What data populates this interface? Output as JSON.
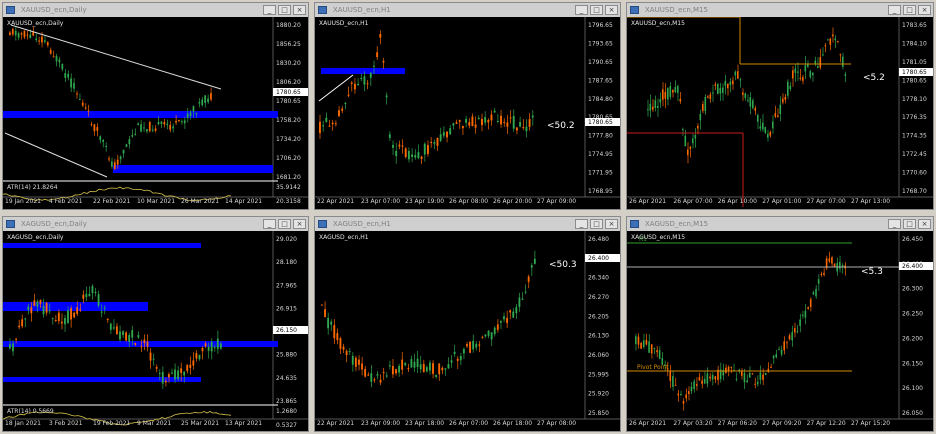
{
  "windows": [
    {
      "id": "w1",
      "title": "XAUUSD_ecn,Daily",
      "symbol_label": "XAUUSD_ecn,Daily",
      "annotation": "",
      "price_labels": [
        "1880.20",
        "1856.25",
        "1830.20",
        "1806.20",
        "1780.65",
        "1758.20",
        "1734.20",
        "1706.20",
        "1681.20"
      ],
      "current_price": "1780.65",
      "date_labels": [
        "19 Jan 2021",
        "4 Feb 2021",
        "22 Feb 2021",
        "10 Mar 2021",
        "26 Mar 2021",
        "14 Apr 2021"
      ],
      "indicator": {
        "label": "ATR(14) 21.8264",
        "scale_labels": [
          "35.9142",
          "20.3158"
        ]
      }
    },
    {
      "id": "w2",
      "title": "XAUUSD_ecn,H1",
      "symbol_label": "XAUUSD_ecn,H1",
      "annotation": "<50.2",
      "price_labels": [
        "1796.65",
        "1793.65",
        "1790.65",
        "1787.65",
        "1784.80",
        "1780.65",
        "1777.80",
        "1774.95",
        "1771.95",
        "1768.95"
      ],
      "current_price": "1780.65",
      "date_labels": [
        "22 Apr 2021",
        "23 Apr 07:00",
        "23 Apr 19:00",
        "26 Apr 08:00",
        "26 Apr 20:00",
        "27 Apr 09:00"
      ]
    },
    {
      "id": "w3",
      "title": "XAUUSD_ecn,M15",
      "symbol_label": "XAUUSD_ecn,M15",
      "annotation": "<5.2",
      "price_labels": [
        "1783.65",
        "1784.10",
        "1781.05",
        "1780.65",
        "1778.10",
        "1776.35",
        "1774.35",
        "1772.45",
        "1770.60",
        "1768.70"
      ],
      "current_price": "1780.65",
      "date_labels": [
        "26 Apr 2021",
        "26 Apr 07:00",
        "26 Apr 10:00",
        "27 Apr 01:00",
        "27 Apr 07:00",
        "27 Apr 13:00"
      ]
    },
    {
      "id": "w4",
      "title": "XAGUSD_ecn,Daily",
      "symbol_label": "XAGUSD_ecn,Daily",
      "annotation": "",
      "price_labels": [
        "29.020",
        "28.180",
        "27.965",
        "26.915",
        "26.150",
        "25.880",
        "24.635",
        "23.865"
      ],
      "current_price": "26.150",
      "date_labels": [
        "18 Jan 2021",
        "3 Feb 2021",
        "19 Feb 2021",
        "9 Mar 2021",
        "25 Mar 2021",
        "13 Apr 2021"
      ],
      "indicator": {
        "label": "ATR(14) 0.5669",
        "scale_labels": [
          "1.2680",
          "0.5327"
        ]
      }
    },
    {
      "id": "w5",
      "title": "XAGUSD_ecn,H1",
      "symbol_label": "XAGUSD_ecn,H1",
      "annotation": "<50.3",
      "price_labels": [
        "26.480",
        "26.400",
        "26.340",
        "26.270",
        "26.205",
        "26.130",
        "26.060",
        "25.995",
        "25.920",
        "25.850"
      ],
      "current_price": "26.400",
      "date_labels": [
        "22 Apr 2021",
        "23 Apr 09:00",
        "23 Apr 18:00",
        "26 Apr 07:00",
        "26 Apr 18:00",
        "27 Apr 08:00"
      ]
    },
    {
      "id": "w6",
      "title": "XAGUSD_ecn,M15",
      "symbol_label": "XAGUSD_ecn,M15",
      "annotation": "<5.3",
      "price_labels": [
        "26.450",
        "26.400",
        "26.300",
        "26.250",
        "26.200",
        "26.150",
        "26.100",
        "26.050"
      ],
      "current_price": "26.400",
      "line_labels": {
        "r1": "R1",
        "pivot": "Pivot Point"
      },
      "date_labels": [
        "26 Apr 2021",
        "27 Apr 03:20",
        "27 Apr 06:20",
        "27 Apr 09:20",
        "27 Apr 12:20",
        "27 Apr 15:20"
      ]
    }
  ],
  "window_buttons": [
    "_",
    "□",
    "×"
  ],
  "colors": {
    "up": "#2fa84f",
    "down": "#ff6a00",
    "zone": "#0000ff",
    "bg": "#000000",
    "atr": "#d6c24a",
    "r1": "#2e9e2e",
    "pivot": "#d48a00",
    "sline": "#cc1b1b"
  }
}
